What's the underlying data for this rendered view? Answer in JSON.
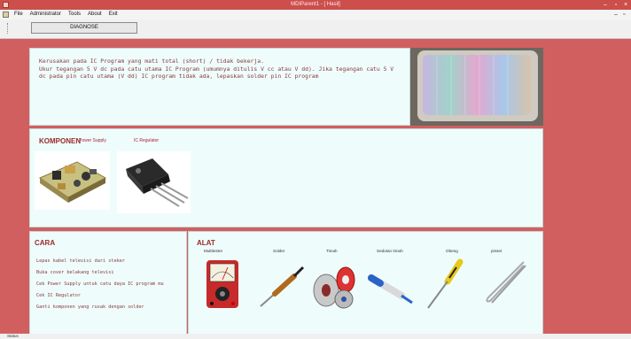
{
  "window": {
    "title": "MDIParent1 - [ Hasil]"
  },
  "menu": {
    "items": [
      "File",
      "Administrator",
      "Tools",
      "About",
      "Exit"
    ]
  },
  "toolbar": {
    "diagnose_label": "DIAGNOSE"
  },
  "description": {
    "text": "Kerusakan pada IC Program yang mati total (short) / tidak bekerja.\nUkur tegangan 5 V dc pada catu utama IC Program (umumnya ditulis V cc atau V dd). Jika tegangan catu 5 V dc pada pin catu utama (V dd) IC program tidak ada, lepaskan solder pin IC program"
  },
  "komponen": {
    "heading": "KOMPONEN",
    "items": [
      "Power Supply",
      "IC Regulator"
    ]
  },
  "cara": {
    "heading": "CARA",
    "steps": [
      "Lepas kabel televisi dari steker",
      "Buka cover belakang televisi",
      "Cek Power Supply untuk catu daya IC program mu",
      "Cek IC Regulator",
      "Ganti komponen yang rusak dengan solder"
    ]
  },
  "alat": {
    "heading": "ALAT",
    "items": [
      "Multitester",
      "Solder",
      "Timah",
      "Sedotan timah",
      "Obeng",
      "pinset"
    ]
  },
  "status": {
    "text": "Status"
  }
}
